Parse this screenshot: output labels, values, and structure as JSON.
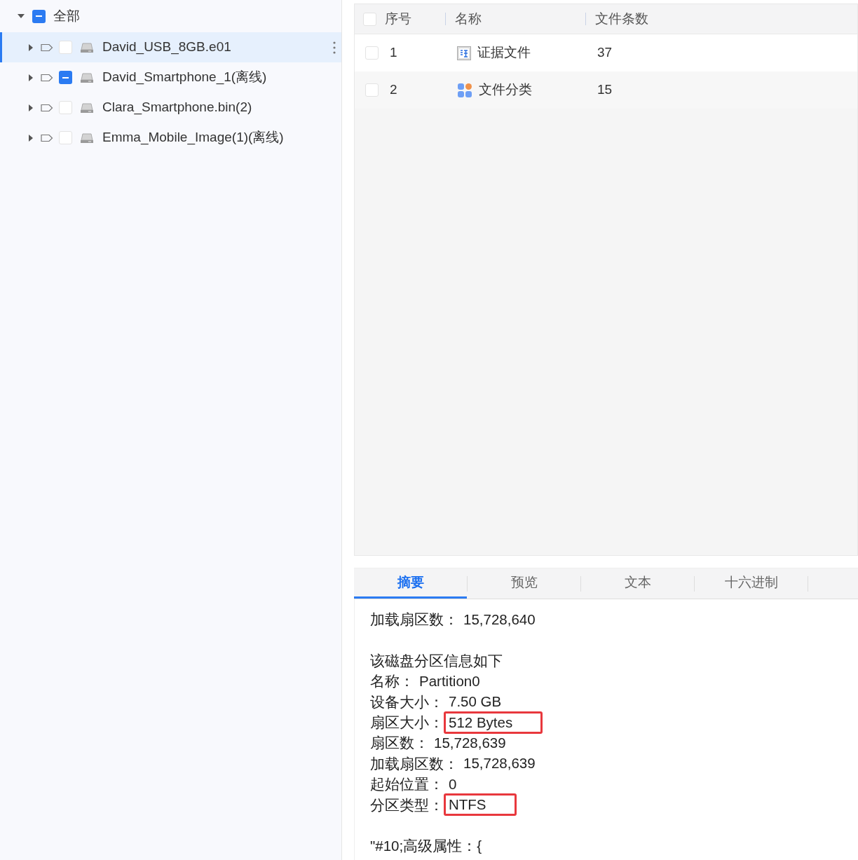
{
  "tree": {
    "label": "全部",
    "expanded": true,
    "indeterminate": true,
    "children": [
      {
        "label": "David_USB_8GB.e01",
        "expanded": false,
        "indeterminate": false,
        "selected": true
      },
      {
        "label": "David_Smartphone_1(离线)",
        "expanded": false,
        "indeterminate": true,
        "selected": false
      },
      {
        "label": "Clara_Smartphone.bin(2)",
        "expanded": false,
        "indeterminate": false,
        "selected": false
      },
      {
        "label": "Emma_Mobile_Image(1)(离线)",
        "expanded": false,
        "indeterminate": false,
        "selected": false
      }
    ]
  },
  "table": {
    "header_checked": false,
    "columns": [
      "序号",
      "名称",
      "文件条数"
    ],
    "rows": [
      {
        "index": "1",
        "name": "证据文件",
        "kind": "evidence",
        "count": "37",
        "checked": false
      },
      {
        "index": "2",
        "name": "文件分类",
        "kind": "category",
        "count": "15",
        "checked": false
      }
    ]
  },
  "detail_tabs": [
    {
      "label": "摘要",
      "selected": true
    },
    {
      "label": "预览",
      "selected": false
    },
    {
      "label": "文本",
      "selected": false
    },
    {
      "label": "十六进制",
      "selected": false
    }
  ],
  "summary_blocks": [
    {
      "lines": [
        {
          "kind": "field",
          "label": "加载扇区数：",
          "value": "15,728,640",
          "highlighted": false
        }
      ]
    },
    {
      "lines": [
        {
          "kind": "heading",
          "label": "该磁盘分区信息如下"
        },
        {
          "kind": "field",
          "label": "名称：",
          "value": "Partition0",
          "highlighted": false
        },
        {
          "kind": "field",
          "label": "设备大小：",
          "value": "7.50 GB",
          "highlighted": false
        },
        {
          "kind": "field",
          "label": "扇区大小：",
          "value": "512 Bytes",
          "highlighted": true
        },
        {
          "kind": "field",
          "label": "扇区数：",
          "value": "15,728,639",
          "highlighted": false
        },
        {
          "kind": "field",
          "label": "加载扇区数：",
          "value": "15,728,639",
          "highlighted": false
        },
        {
          "kind": "field",
          "label": "起始位置：",
          "value": "0",
          "highlighted": false
        },
        {
          "kind": "field",
          "label": "分区类型：",
          "value": "NTFS",
          "highlighted": true
        }
      ]
    },
    {
      "lines": [
        {
          "kind": "heading",
          "label": "\"#10;高级属性：{"
        }
      ]
    }
  ]
}
